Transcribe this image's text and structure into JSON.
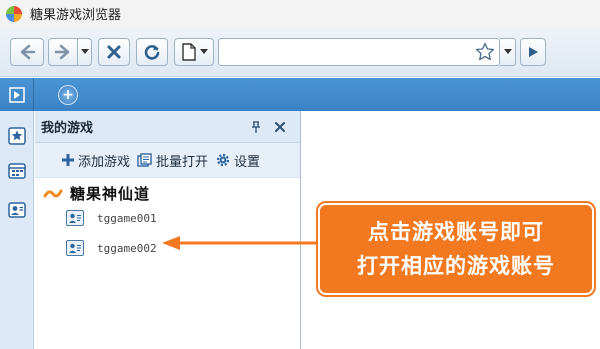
{
  "window": {
    "title": "糖果游戏浏览器"
  },
  "toolbar": {
    "back_icon": "arrow-left-icon",
    "forward_icon": "arrow-right-icon",
    "stop_icon": "close-x-icon",
    "refresh_icon": "refresh-icon",
    "page_icon": "document-icon",
    "address_value": "",
    "favorite_icon": "star-icon"
  },
  "panel": {
    "title": "我的游戏",
    "actions": [
      {
        "label": "添加游戏",
        "icon": "plus-icon"
      },
      {
        "label": "批量打开",
        "icon": "batch-open-icon"
      },
      {
        "label": "设置",
        "icon": "gear-icon"
      }
    ],
    "game": {
      "name": "糖果神仙道"
    },
    "accounts": [
      "tggame001",
      "tggame002"
    ]
  },
  "annotation": {
    "line1": "点击游戏账号即可",
    "line2": "打开相应的游戏账号"
  },
  "colors": {
    "tabstrip": "#3a82c5",
    "panel_header": "#dde9f6",
    "callout": "#f27920"
  }
}
